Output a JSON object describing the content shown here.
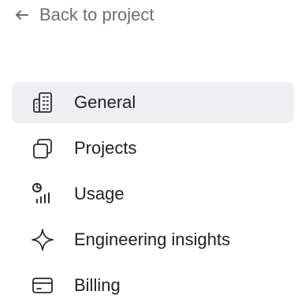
{
  "back_link": {
    "label": "Back to project",
    "icon": "arrow-left-icon"
  },
  "nav": {
    "items": [
      {
        "label": "General",
        "icon": "building-icon",
        "active": true
      },
      {
        "label": "Projects",
        "icon": "projects-icon",
        "active": false
      },
      {
        "label": "Usage",
        "icon": "usage-icon",
        "active": false
      },
      {
        "label": "Engineering insights",
        "icon": "sparkle-icon",
        "active": false
      },
      {
        "label": "Billing",
        "icon": "credit-card-icon",
        "active": false
      }
    ]
  },
  "colors": {
    "active_background": "#efeff2",
    "text": "#1f2024",
    "muted_text": "#6b6f76"
  }
}
